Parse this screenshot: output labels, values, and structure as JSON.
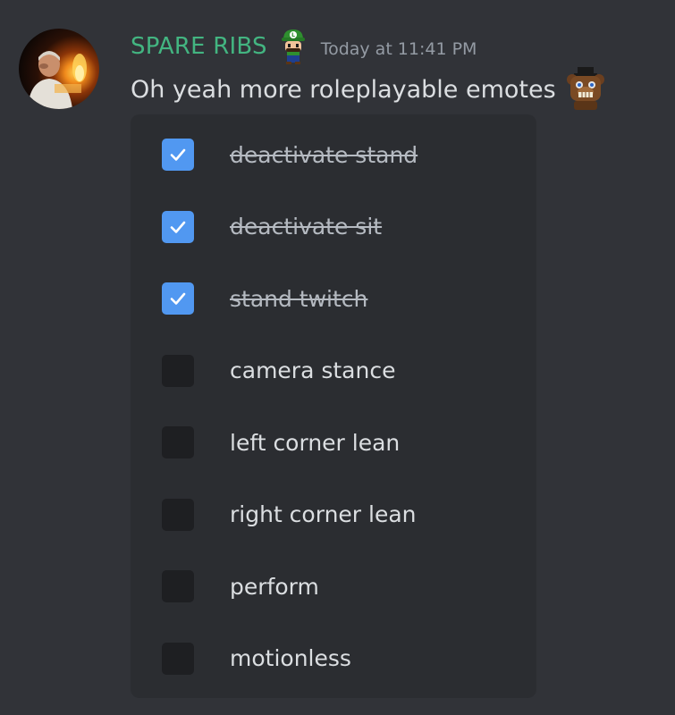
{
  "message": {
    "author": "SPARE RIBS",
    "author_color": "#43b581",
    "role_icon": "luigi-emoji-icon",
    "timestamp": "Today at 11:41 PM",
    "text": "Oh yeah more roleplayable emotes",
    "text_emoji": "freddy-fazbear-emoji-icon"
  },
  "checklist": {
    "accent": "#5198f1",
    "items": [
      {
        "label": "deactivate stand",
        "checked": true
      },
      {
        "label": "deactivate sit",
        "checked": true
      },
      {
        "label": "stand twitch",
        "checked": true
      },
      {
        "label": "camera stance",
        "checked": false
      },
      {
        "label": "left corner lean",
        "checked": false
      },
      {
        "label": "right corner lean",
        "checked": false
      },
      {
        "label": "perform",
        "checked": false
      },
      {
        "label": "motionless",
        "checked": false
      }
    ]
  }
}
